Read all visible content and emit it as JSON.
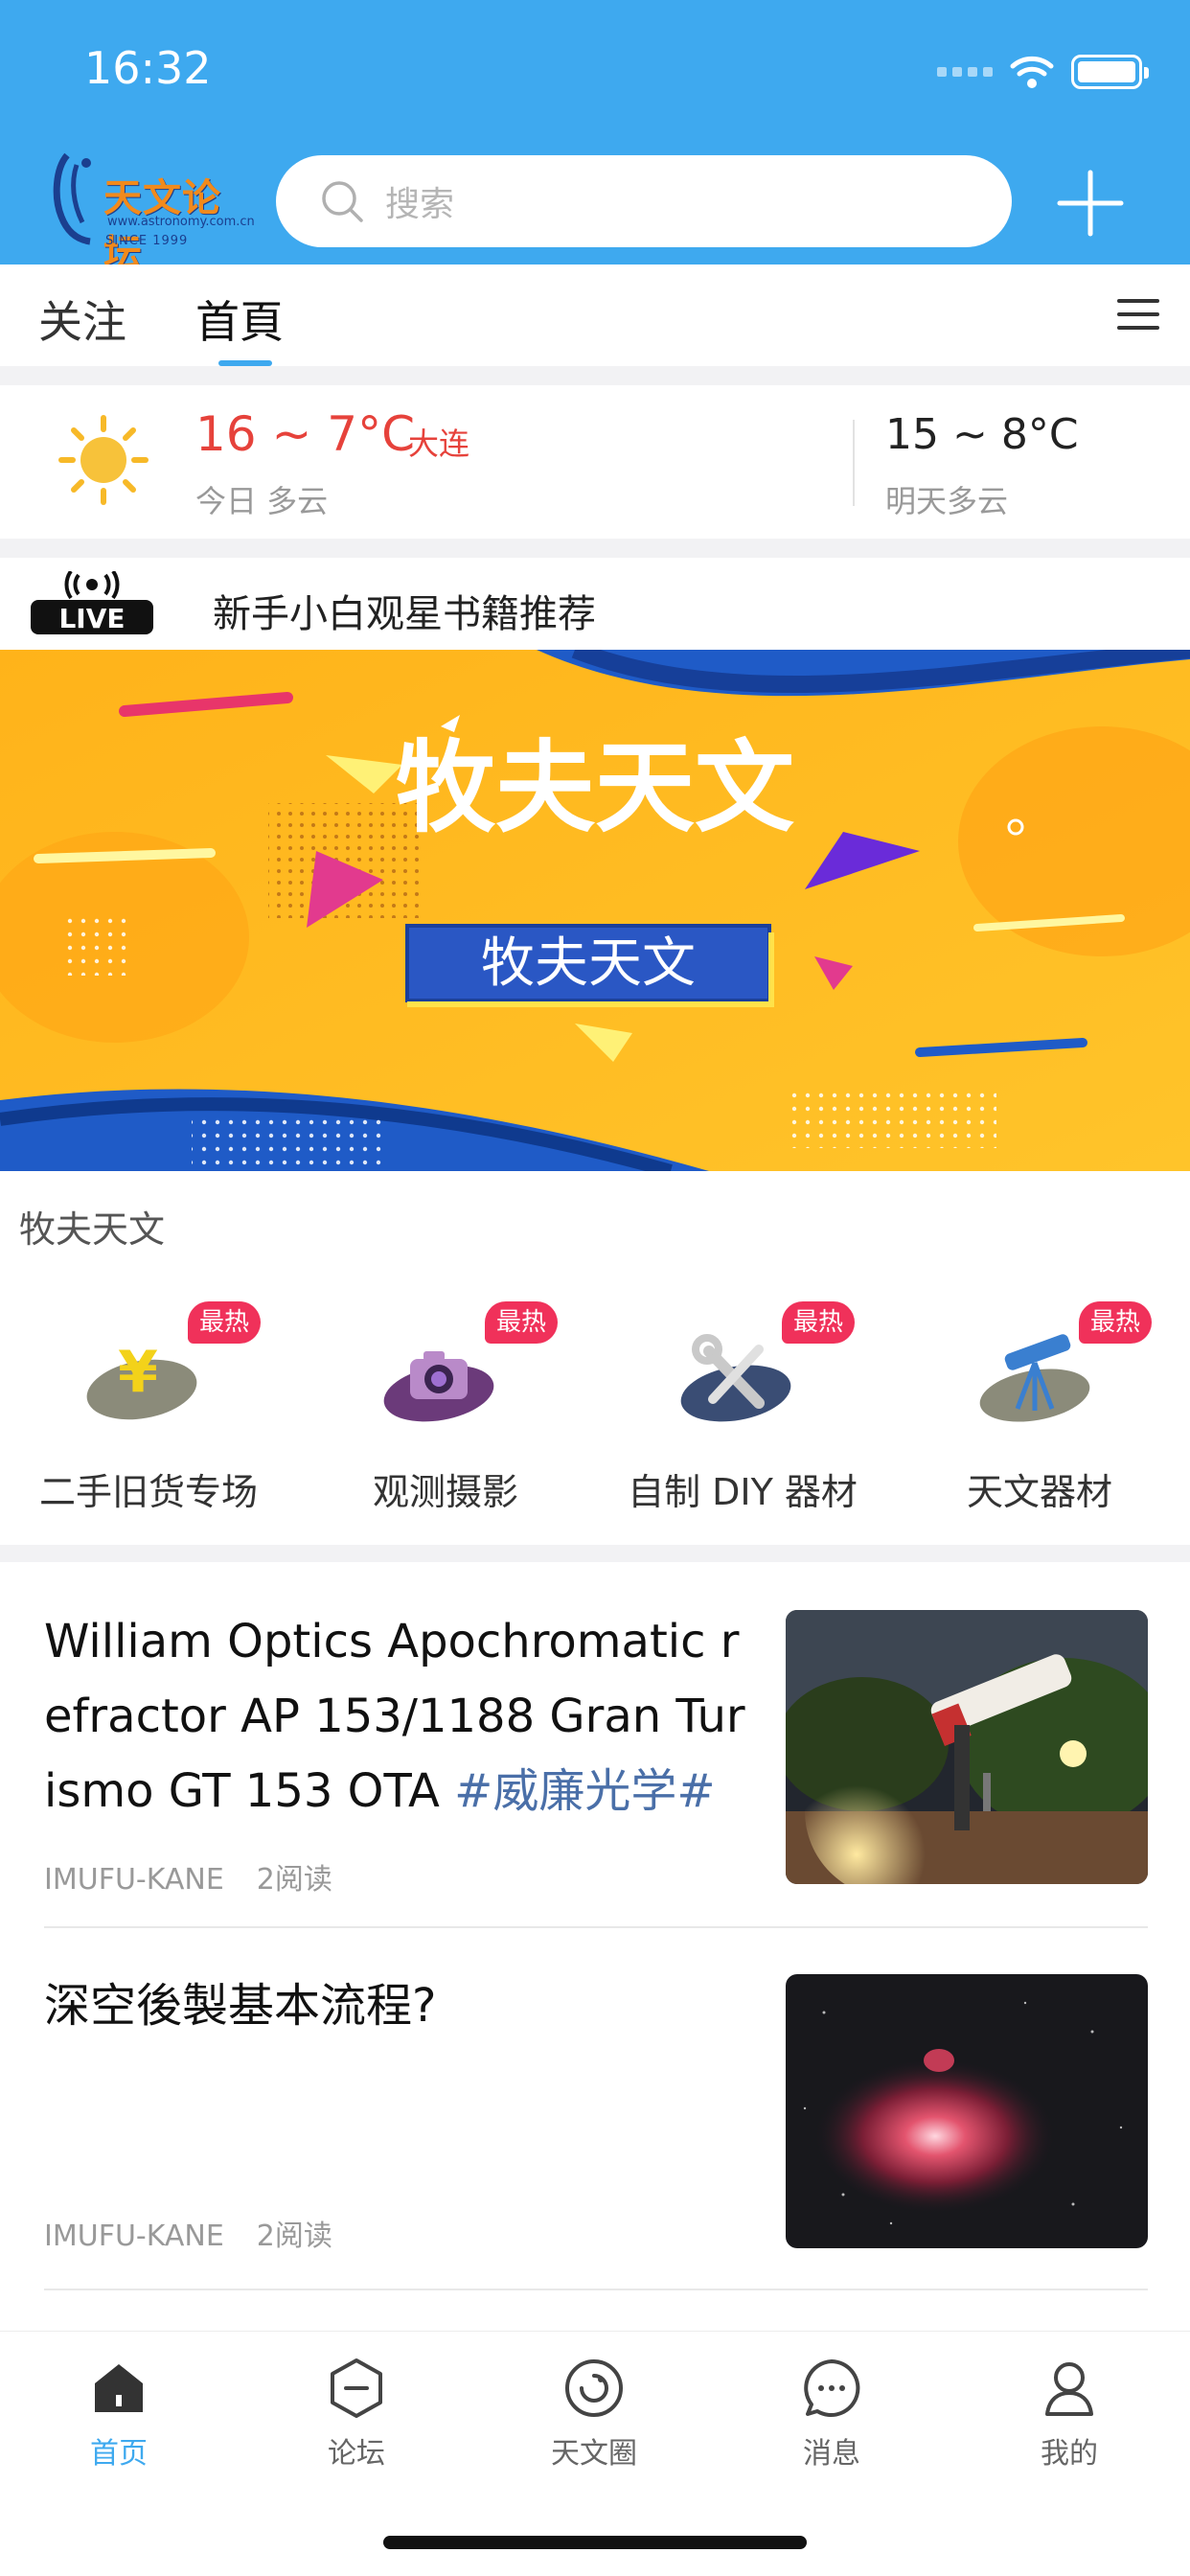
{
  "status_bar": {
    "time": "16:32"
  },
  "header": {
    "logo": {
      "main": "天文论坛",
      "url": "www.astronomy.com.cn",
      "since": "SINCE 1999"
    },
    "search": {
      "placeholder": "搜索"
    }
  },
  "tabs": [
    {
      "label": "关注",
      "active": false
    },
    {
      "label": "首頁",
      "active": true
    }
  ],
  "weather": {
    "today_temp": "16 ~ 7°C",
    "city": "大连",
    "today_desc": "今日 多云",
    "tomorrow_temp": "15 ~ 8°C",
    "tomorrow_desc": "明天多云",
    "icon": "sun-icon"
  },
  "live": {
    "badge": "LIVE",
    "text": "新手小白观星书籍推荐"
  },
  "banner": {
    "title": "牧夫天文",
    "subtitle": "牧夫天文"
  },
  "section_label": "牧夫天文",
  "categories": [
    {
      "label": "二手旧货专场",
      "badge": "最热",
      "icon": "yen-icon"
    },
    {
      "label": "观测摄影",
      "badge": "最热",
      "icon": "camera-icon"
    },
    {
      "label": "自制 DIY 器材",
      "badge": "最热",
      "icon": "tools-icon"
    },
    {
      "label": "天文器材",
      "badge": "最热",
      "icon": "telescope-icon"
    }
  ],
  "articles": [
    {
      "title": "William Optics Apochromatic refractor AP 153/1188 Gran Turismo GT 153 OTA ",
      "tag": "#威廉光学#",
      "author": "IMUFU-KANE",
      "reads": "2阅读"
    },
    {
      "title": "深空後製基本流程?",
      "tag": "",
      "author": "IMUFU-KANE",
      "reads": "2阅读"
    }
  ],
  "bottom_nav": [
    {
      "label": "首页",
      "icon": "home-icon",
      "active": true
    },
    {
      "label": "论坛",
      "icon": "forum-icon",
      "active": false
    },
    {
      "label": "天文圈",
      "icon": "circle-icon",
      "active": false
    },
    {
      "label": "消息",
      "icon": "message-icon",
      "active": false
    },
    {
      "label": "我的",
      "icon": "profile-icon",
      "active": false
    }
  ],
  "colors": {
    "brand_blue": "#3ea9ef",
    "temp_red": "#e6423b",
    "badge_red": "#f0315a",
    "tag_blue": "#4a6fa8"
  }
}
